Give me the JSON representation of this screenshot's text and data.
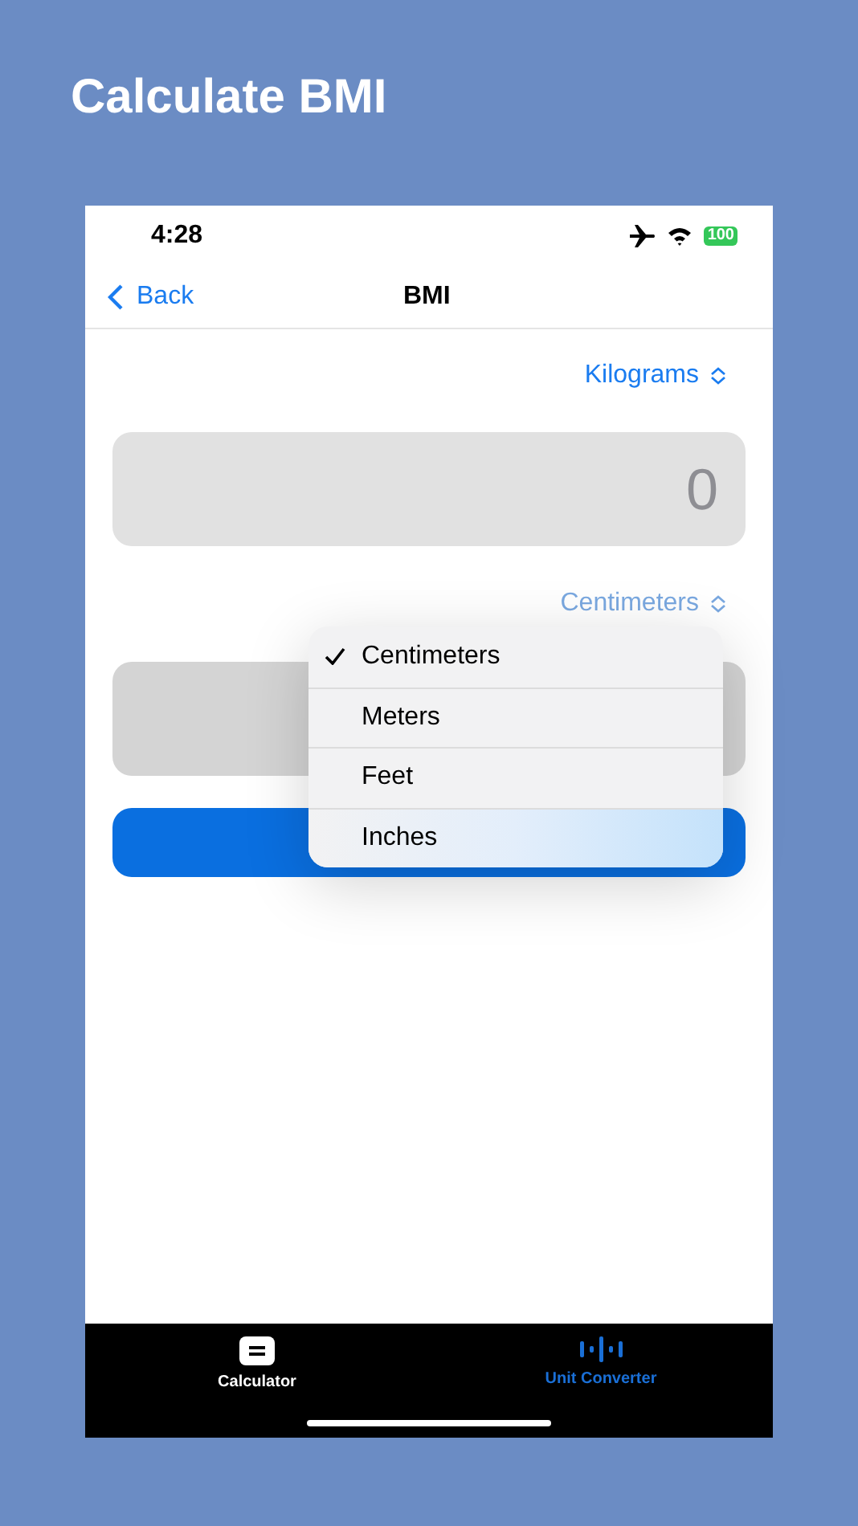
{
  "heading": "Calculate BMI",
  "status_bar": {
    "time": "4:28",
    "battery": "100"
  },
  "nav": {
    "back": "Back",
    "title": "BMI"
  },
  "weight_unit": {
    "label": "Kilograms"
  },
  "weight_field": {
    "value": "0"
  },
  "height_unit": {
    "label": "Centimeters"
  },
  "unit_menu": [
    {
      "label": "Centimeters",
      "selected": true
    },
    {
      "label": "Meters",
      "selected": false
    },
    {
      "label": "Feet",
      "selected": false
    },
    {
      "label": "Inches",
      "selected": false
    }
  ],
  "tabs": [
    {
      "label": "Calculator",
      "kind": "calculator",
      "selected": false
    },
    {
      "label": "Unit Converter",
      "kind": "converter",
      "selected": true
    }
  ]
}
